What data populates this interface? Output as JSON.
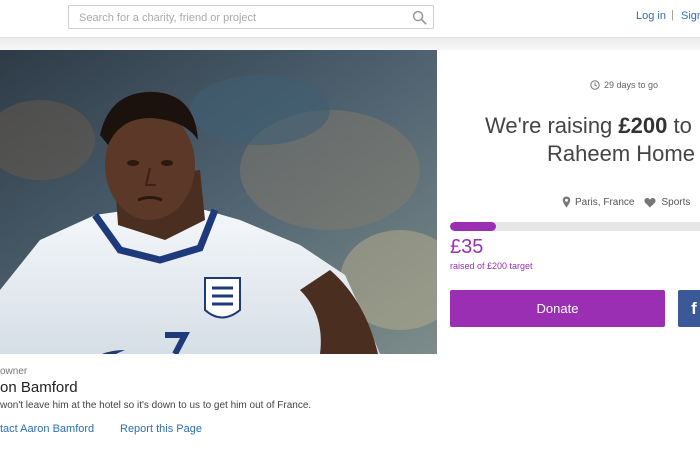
{
  "header": {
    "search_placeholder": "Search for a charity, friend or project",
    "login_label": "Log in",
    "separator": "|",
    "signup_label": "Sign"
  },
  "hero": {
    "image_subject": "football player in white England national team shirt with three lions crest and number 7"
  },
  "campaign": {
    "days_left": "29 days to go",
    "headline_prefix": "We're raising ",
    "goal": "£200",
    "headline_suffix": " to",
    "headline_line2": "Raheem Home",
    "location": "Paris, France",
    "category": "Sports",
    "raised_amount": "£35",
    "target_text": "raised of £200 target",
    "progress_fraction": 0.175,
    "donate_label": "Donate",
    "facebook_label": "f",
    "accent_color": "#9b2fb4",
    "facebook_color": "#3b5998"
  },
  "owner": {
    "label": "owner",
    "name": "on Bamford",
    "description": "won't leave him at the hotel so it's down to us to get him out of France.",
    "contact_label": "tact Aaron Bamford",
    "report_label": "Report this Page"
  },
  "icons": {
    "search": "magnifier",
    "clock": "clock",
    "location": "map-pin",
    "category": "heart"
  }
}
